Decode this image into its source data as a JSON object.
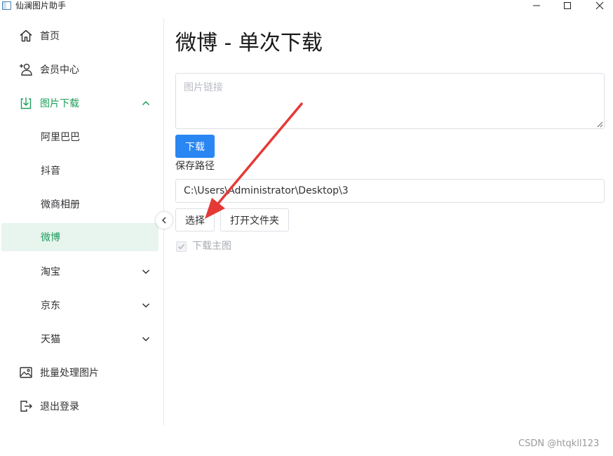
{
  "window": {
    "title": "仙澜图片助手"
  },
  "sidebar": {
    "items": [
      {
        "label": "首页",
        "icon": "home-icon"
      },
      {
        "label": "会员中心",
        "icon": "user-add-icon"
      },
      {
        "label": "图片下载",
        "icon": "download-icon",
        "expanded": true
      },
      {
        "label": "阿里巴巴"
      },
      {
        "label": "抖音"
      },
      {
        "label": "微商相册"
      },
      {
        "label": "微博",
        "active": true
      },
      {
        "label": "淘宝",
        "icon": "chevron-down-icon"
      },
      {
        "label": "京东",
        "icon": "chevron-down-icon"
      },
      {
        "label": "天猫",
        "icon": "chevron-down-icon"
      },
      {
        "label": "批量处理图片",
        "icon": "image-icon"
      },
      {
        "label": "退出登录",
        "icon": "logout-icon"
      }
    ]
  },
  "main": {
    "title": "微博 - 单次下载",
    "url_placeholder": "图片链接",
    "download_label": "下载",
    "save_path_label": "保存路径",
    "save_path_value": "C:\\Users\\Administrator\\Desktop\\3",
    "choose_label": "选择",
    "open_folder_label": "打开文件夹",
    "main_image_checkbox_label": "下载主图",
    "main_image_checked": true
  },
  "watermark": "CSDN @htqkll123",
  "colors": {
    "accent_green": "#1d9d5b",
    "active_bg": "#e8f4ee",
    "primary_blue": "#2a86f2",
    "annotation_red": "#e53935"
  }
}
